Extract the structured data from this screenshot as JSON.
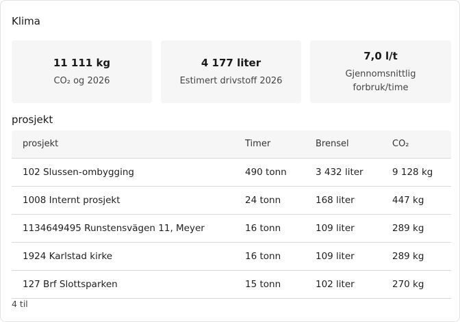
{
  "klima": {
    "title": "Klima",
    "cards": [
      {
        "value": "11 111 kg",
        "label": "CO₂ og 2026"
      },
      {
        "value": "4 177 liter",
        "label": "Estimert drivstoff 2026"
      },
      {
        "value": "7,0 l/t",
        "label_line1": "Gjennomsnittlig",
        "label_line2": "forbruk/time"
      }
    ]
  },
  "prosjekt": {
    "title": "prosjekt",
    "columns": [
      "prosjekt",
      "Timer",
      "Brensel",
      "CO₂"
    ],
    "rows": [
      [
        "102 Slussen-ombygging",
        "490 tonn",
        "3 432 liter",
        "9 128 kg"
      ],
      [
        "1008 Internt prosjekt",
        "24 tonn",
        "168 liter",
        "447 kg"
      ],
      [
        "1134649495 Runstensvägen 11, Meyer",
        "16 tonn",
        "109 liter",
        "289 kg"
      ],
      [
        "1924 Karlstad kirke",
        "16 tonn",
        "109 liter",
        "289 kg"
      ],
      [
        "127 Brf Slottsparken",
        "15 tonn",
        "102 liter",
        "270 kg"
      ]
    ],
    "more_link": "4 til"
  }
}
